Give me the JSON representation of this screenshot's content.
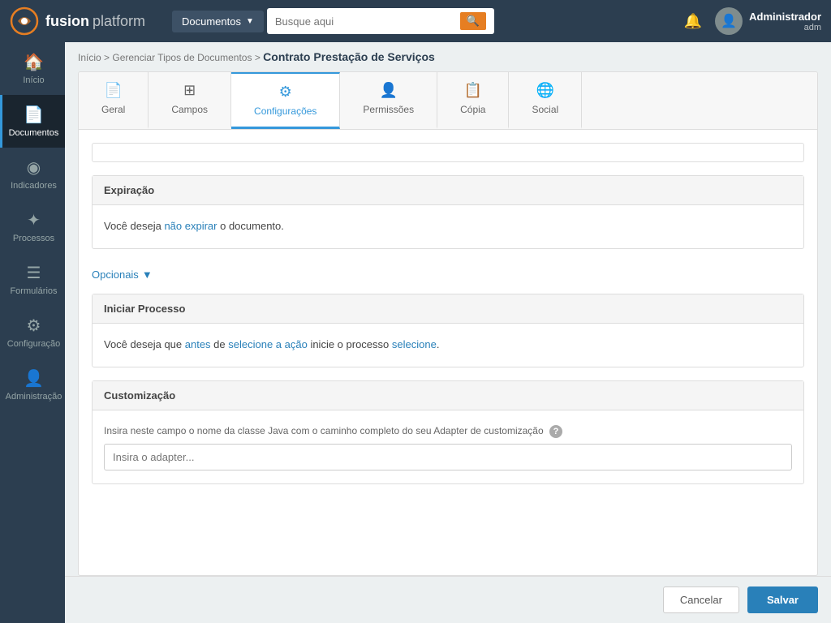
{
  "app": {
    "name_bold": "fusion",
    "name_light": "platform"
  },
  "topnav": {
    "documents_label": "Documentos",
    "search_placeholder": "Busque aqui",
    "user_name": "Administrador",
    "user_role": "adm"
  },
  "breadcrumb": {
    "inicio": "Início",
    "gerenciar": "Gerenciar Tipos de Documentos",
    "current": "Contrato Prestação de Serviços"
  },
  "tabs": [
    {
      "id": "geral",
      "label": "Geral",
      "icon": "📄"
    },
    {
      "id": "campos",
      "label": "Campos",
      "icon": "⊞"
    },
    {
      "id": "configuracoes",
      "label": "Configurações",
      "icon": "⚙"
    },
    {
      "id": "permissoes",
      "label": "Permissões",
      "icon": "👤"
    },
    {
      "id": "copia",
      "label": "Cópia",
      "icon": "📋"
    },
    {
      "id": "social",
      "label": "Social",
      "icon": "🌐"
    }
  ],
  "sidebar": {
    "items": [
      {
        "id": "inicio",
        "label": "Início",
        "icon": "🏠"
      },
      {
        "id": "documentos",
        "label": "Documentos",
        "icon": "📄"
      },
      {
        "id": "indicadores",
        "label": "Indicadores",
        "icon": "◉"
      },
      {
        "id": "processos",
        "label": "Processos",
        "icon": "✦"
      },
      {
        "id": "formularios",
        "label": "Formulários",
        "icon": "☰"
      },
      {
        "id": "configuracao",
        "label": "Configuração",
        "icon": "⚙"
      },
      {
        "id": "administracao",
        "label": "Administração",
        "icon": "👤"
      }
    ]
  },
  "sections": {
    "expiracao": {
      "title": "Expiração",
      "text_before": "Você deseja ",
      "link_text": "não expirar",
      "text_after": " o documento."
    },
    "opcionais": {
      "label": "Opcionais",
      "caret": "▼"
    },
    "iniciar_processo": {
      "title": "Iniciar Processo",
      "text_before": "Você deseja que ",
      "link1": "antes",
      "text_mid1": " de ",
      "link2": "selecione a ação",
      "text_mid2": " inicie o processo ",
      "link3": "selecione",
      "text_end": "."
    },
    "customizacao": {
      "title": "Customização",
      "field_label": "Insira neste campo o nome da classe Java com o caminho completo do seu Adapter de customização",
      "field_placeholder": "Insira o adapter..."
    }
  },
  "footer": {
    "cancel_label": "Cancelar",
    "save_label": "Salvar"
  }
}
